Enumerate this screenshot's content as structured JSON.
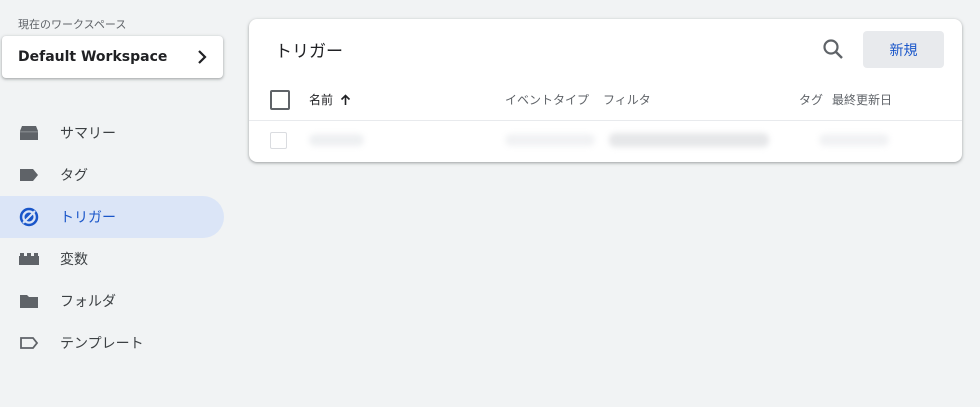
{
  "sidebar": {
    "workspace_caption": "現在のワークスペース",
    "workspace_name": "Default Workspace",
    "items": [
      {
        "label": "サマリー",
        "icon": "summary-icon"
      },
      {
        "label": "タグ",
        "icon": "tag-icon"
      },
      {
        "label": "トリガー",
        "icon": "trigger-icon",
        "active": true
      },
      {
        "label": "変数",
        "icon": "variable-icon"
      },
      {
        "label": "フォルダ",
        "icon": "folder-icon"
      },
      {
        "label": "テンプレート",
        "icon": "template-icon"
      }
    ]
  },
  "main": {
    "title": "トリガー",
    "new_button": "新規",
    "columns": {
      "name": "名前",
      "event_type": "イベントタイプ",
      "filter": "フィルタ",
      "tag": "タグ",
      "last_updated": "最終更新日"
    }
  },
  "colors": {
    "accent": "#1a56c9",
    "active_bg": "#dbe5f7",
    "background": "#f1f3f4"
  }
}
